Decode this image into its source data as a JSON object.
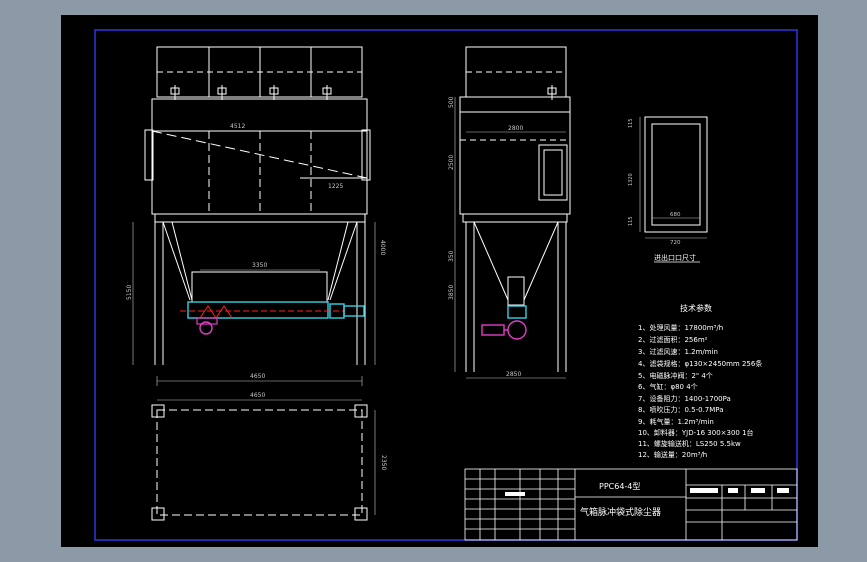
{
  "colors": {
    "background": "#8c99a6",
    "sheet": "#000000",
    "border": "#2a35d6",
    "line": "#ffffff",
    "dim": "#c8c8c8",
    "cyan": "#32d2e6",
    "magenta": "#e23cc8",
    "red": "#ff2020"
  },
  "front_view": {
    "dim_top": "4512",
    "dim_side": "1225",
    "dim_screw": "3350",
    "dim_width": "4650",
    "dim_height_left": "5150",
    "dim_height_right": "4000"
  },
  "side_view": {
    "dim_top_left": "500",
    "dim_a": "2800",
    "dim_b": "2500",
    "dim_c": "350",
    "dim_d": "3850",
    "dim_bottom": "2850"
  },
  "plan_view": {
    "dim_top": "4650",
    "dim_side": "2350"
  },
  "inlet": {
    "caption": "进出口口尺寸",
    "dim_inner": "680",
    "dim_outer": "720",
    "dim_v1": "115",
    "dim_v2": "1320",
    "dim_v3": "115"
  },
  "tech": {
    "title": "技术参数",
    "params": [
      "1、处理风量：17800m³/h",
      "2、过滤面积：256m²",
      "3、过滤风速：1.2m/min",
      "4、滤袋规格：φ130×2450mm   256条",
      "5、电磁脉冲阀：2\"   4个",
      "6、气缸：φ80   4个",
      "7、设备阻力：1400-1700Pa",
      "8、喷吹压力：0.5-0.7MPa",
      "9、耗气量：1.2m³/min",
      "10、卸料器：YJD-16   300×300  1台",
      "11、螺旋输送机：LS250   5.5kw",
      "12、输送量：20m³/h"
    ]
  },
  "title_block": {
    "model": "PPC64-4型",
    "name": "气箱脉冲袋式除尘器"
  }
}
